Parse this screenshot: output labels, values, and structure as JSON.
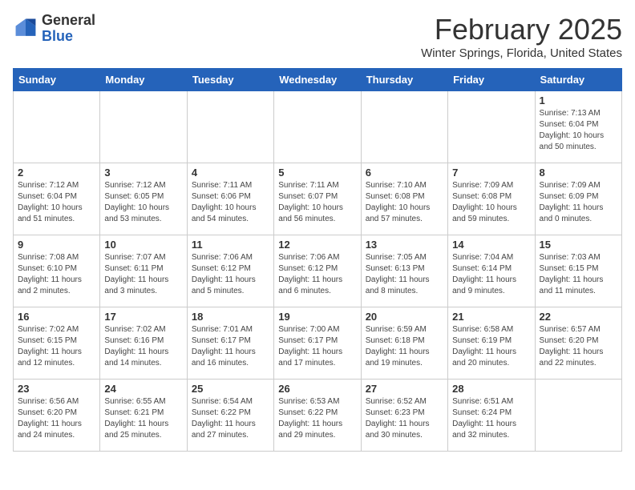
{
  "header": {
    "logo_general": "General",
    "logo_blue": "Blue",
    "month_title": "February 2025",
    "location": "Winter Springs, Florida, United States"
  },
  "days_of_week": [
    "Sunday",
    "Monday",
    "Tuesday",
    "Wednesday",
    "Thursday",
    "Friday",
    "Saturday"
  ],
  "weeks": [
    [
      {
        "day": "",
        "info": ""
      },
      {
        "day": "",
        "info": ""
      },
      {
        "day": "",
        "info": ""
      },
      {
        "day": "",
        "info": ""
      },
      {
        "day": "",
        "info": ""
      },
      {
        "day": "",
        "info": ""
      },
      {
        "day": "1",
        "info": "Sunrise: 7:13 AM\nSunset: 6:04 PM\nDaylight: 10 hours and 50 minutes."
      }
    ],
    [
      {
        "day": "2",
        "info": "Sunrise: 7:12 AM\nSunset: 6:04 PM\nDaylight: 10 hours and 51 minutes."
      },
      {
        "day": "3",
        "info": "Sunrise: 7:12 AM\nSunset: 6:05 PM\nDaylight: 10 hours and 53 minutes."
      },
      {
        "day": "4",
        "info": "Sunrise: 7:11 AM\nSunset: 6:06 PM\nDaylight: 10 hours and 54 minutes."
      },
      {
        "day": "5",
        "info": "Sunrise: 7:11 AM\nSunset: 6:07 PM\nDaylight: 10 hours and 56 minutes."
      },
      {
        "day": "6",
        "info": "Sunrise: 7:10 AM\nSunset: 6:08 PM\nDaylight: 10 hours and 57 minutes."
      },
      {
        "day": "7",
        "info": "Sunrise: 7:09 AM\nSunset: 6:08 PM\nDaylight: 10 hours and 59 minutes."
      },
      {
        "day": "8",
        "info": "Sunrise: 7:09 AM\nSunset: 6:09 PM\nDaylight: 11 hours and 0 minutes."
      }
    ],
    [
      {
        "day": "9",
        "info": "Sunrise: 7:08 AM\nSunset: 6:10 PM\nDaylight: 11 hours and 2 minutes."
      },
      {
        "day": "10",
        "info": "Sunrise: 7:07 AM\nSunset: 6:11 PM\nDaylight: 11 hours and 3 minutes."
      },
      {
        "day": "11",
        "info": "Sunrise: 7:06 AM\nSunset: 6:12 PM\nDaylight: 11 hours and 5 minutes."
      },
      {
        "day": "12",
        "info": "Sunrise: 7:06 AM\nSunset: 6:12 PM\nDaylight: 11 hours and 6 minutes."
      },
      {
        "day": "13",
        "info": "Sunrise: 7:05 AM\nSunset: 6:13 PM\nDaylight: 11 hours and 8 minutes."
      },
      {
        "day": "14",
        "info": "Sunrise: 7:04 AM\nSunset: 6:14 PM\nDaylight: 11 hours and 9 minutes."
      },
      {
        "day": "15",
        "info": "Sunrise: 7:03 AM\nSunset: 6:15 PM\nDaylight: 11 hours and 11 minutes."
      }
    ],
    [
      {
        "day": "16",
        "info": "Sunrise: 7:02 AM\nSunset: 6:15 PM\nDaylight: 11 hours and 12 minutes."
      },
      {
        "day": "17",
        "info": "Sunrise: 7:02 AM\nSunset: 6:16 PM\nDaylight: 11 hours and 14 minutes."
      },
      {
        "day": "18",
        "info": "Sunrise: 7:01 AM\nSunset: 6:17 PM\nDaylight: 11 hours and 16 minutes."
      },
      {
        "day": "19",
        "info": "Sunrise: 7:00 AM\nSunset: 6:17 PM\nDaylight: 11 hours and 17 minutes."
      },
      {
        "day": "20",
        "info": "Sunrise: 6:59 AM\nSunset: 6:18 PM\nDaylight: 11 hours and 19 minutes."
      },
      {
        "day": "21",
        "info": "Sunrise: 6:58 AM\nSunset: 6:19 PM\nDaylight: 11 hours and 20 minutes."
      },
      {
        "day": "22",
        "info": "Sunrise: 6:57 AM\nSunset: 6:20 PM\nDaylight: 11 hours and 22 minutes."
      }
    ],
    [
      {
        "day": "23",
        "info": "Sunrise: 6:56 AM\nSunset: 6:20 PM\nDaylight: 11 hours and 24 minutes."
      },
      {
        "day": "24",
        "info": "Sunrise: 6:55 AM\nSunset: 6:21 PM\nDaylight: 11 hours and 25 minutes."
      },
      {
        "day": "25",
        "info": "Sunrise: 6:54 AM\nSunset: 6:22 PM\nDaylight: 11 hours and 27 minutes."
      },
      {
        "day": "26",
        "info": "Sunrise: 6:53 AM\nSunset: 6:22 PM\nDaylight: 11 hours and 29 minutes."
      },
      {
        "day": "27",
        "info": "Sunrise: 6:52 AM\nSunset: 6:23 PM\nDaylight: 11 hours and 30 minutes."
      },
      {
        "day": "28",
        "info": "Sunrise: 6:51 AM\nSunset: 6:24 PM\nDaylight: 11 hours and 32 minutes."
      },
      {
        "day": "",
        "info": ""
      }
    ]
  ]
}
